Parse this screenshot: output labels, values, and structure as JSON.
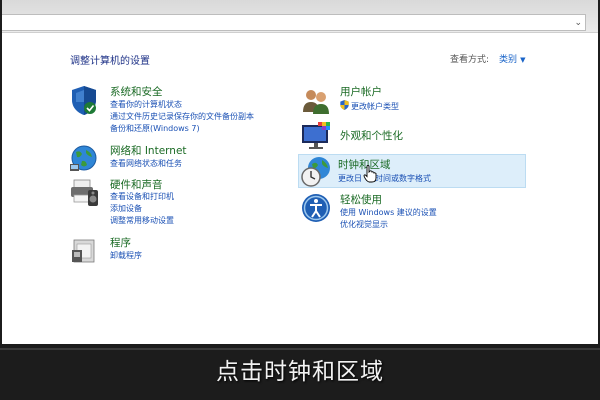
{
  "header": {
    "title": "调整计算机的设置",
    "view_by_label": "查看方式:",
    "view_by_value": "类别"
  },
  "left_categories": [
    {
      "title": "系统和安全",
      "icon": "shield-icon",
      "links": [
        "查看你的计算机状态",
        "通过文件历史记录保存你的文件备份副本",
        "备份和还原(Windows 7)"
      ]
    },
    {
      "title": "网络和 Internet",
      "icon": "network-globe-icon",
      "links": [
        "查看网络状态和任务"
      ]
    },
    {
      "title": "硬件和声音",
      "icon": "printer-speaker-icon",
      "links": [
        "查看设备和打印机",
        "添加设备",
        "调整常用移动设置"
      ]
    },
    {
      "title": "程序",
      "icon": "programs-icon",
      "links": [
        "卸载程序"
      ]
    }
  ],
  "right_categories": [
    {
      "title": "用户帐户",
      "icon": "users-icon",
      "links": [
        "更改帐户类型"
      ]
    },
    {
      "title": "外观和个性化",
      "icon": "display-personalize-icon",
      "links": []
    },
    {
      "title": "时钟和区域",
      "icon": "clock-globe-icon",
      "links": [
        "更改日",
        "时间或数字格式"
      ]
    },
    {
      "title": "轻松使用",
      "icon": "ease-of-access-icon",
      "links": [
        "使用 Windows 建议的设置",
        "优化视觉显示"
      ]
    }
  ],
  "caption": "点击时钟和区域",
  "colors": {
    "category_title": "#1a6a24",
    "link": "#1a50b4",
    "panel_title": "#1e3287",
    "hover_bg": "#ddeefa"
  }
}
